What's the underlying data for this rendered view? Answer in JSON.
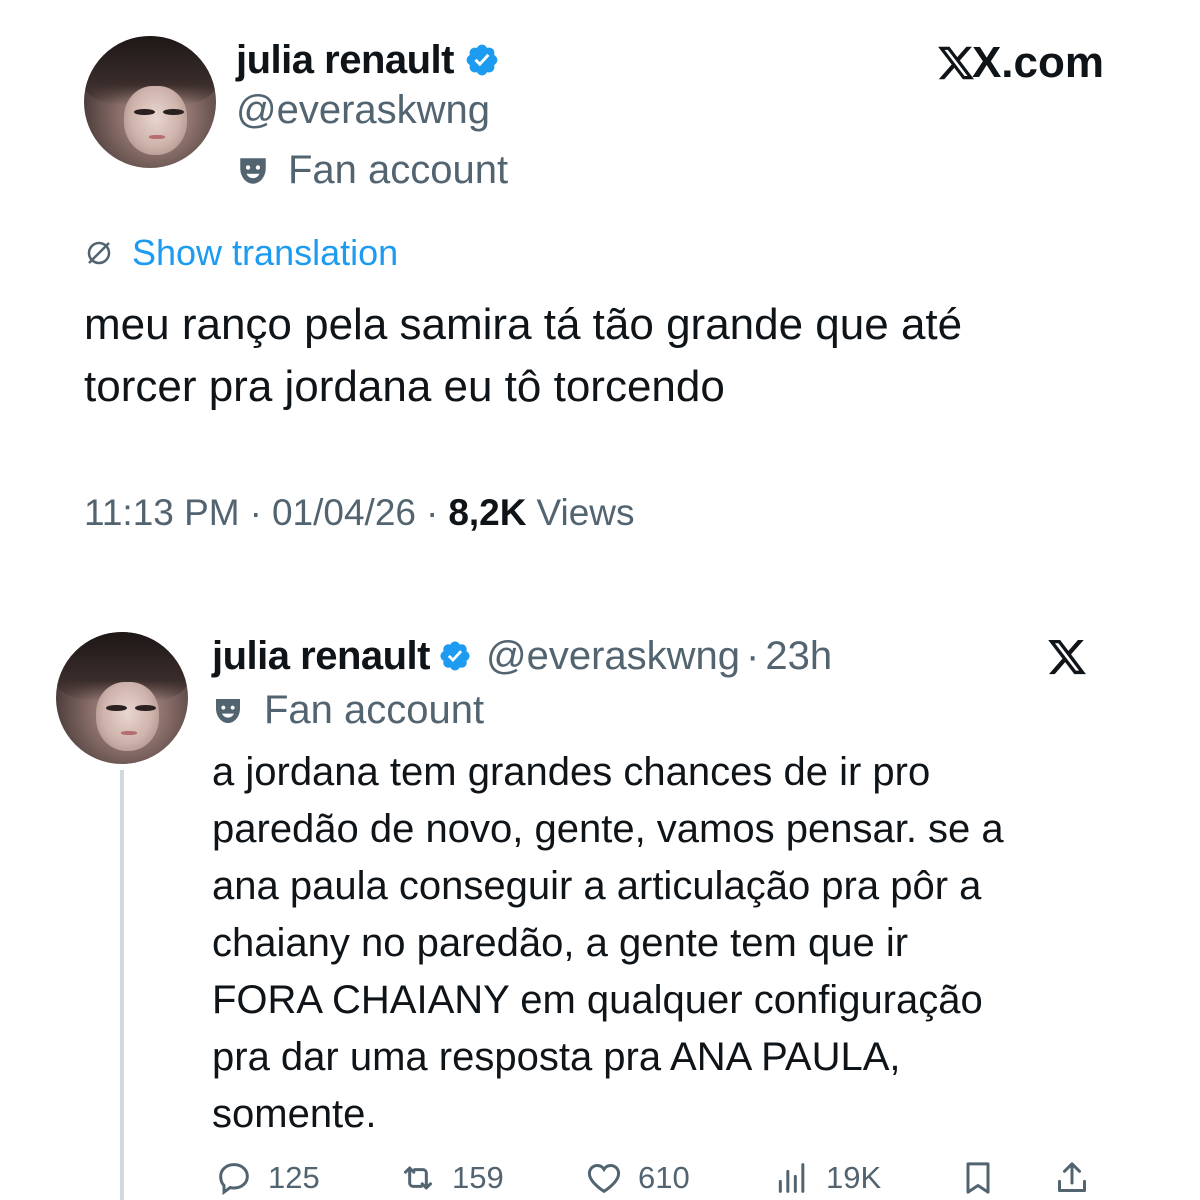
{
  "main_tweet": {
    "author": {
      "display_name": "julia renault",
      "handle": "@everaskwng",
      "label": "Fan account",
      "verified": true
    },
    "brand": "X.com",
    "show_translation": "Show translation",
    "text_lines": [
      "meu ranço pela samira tá tão grande que até",
      "torcer pra jordana eu tô torcendo"
    ],
    "meta": {
      "time": "11:13 PM",
      "separator": "·",
      "date": "01/04/26",
      "views_count": "8,2K",
      "views_label": "Views"
    }
  },
  "quoted_tweet": {
    "author": {
      "display_name": "julia renault",
      "handle": "@everaskwng",
      "separator": "·",
      "time": "23h",
      "label": "Fan account",
      "verified": true
    },
    "text_lines": [
      "a jordana tem grandes chances de ir pro",
      "paredão de novo, gente, vamos pensar. se a",
      "ana paula conseguir a articulação pra pôr a",
      "chaiany no paredão, a gente tem que ir",
      "FORA CHAIANY em qualquer configuração",
      "pra dar uma resposta pra ANA PAULA,",
      "somente."
    ],
    "actions": {
      "replies": "125",
      "reposts": "159",
      "likes": "610",
      "views": "19K"
    }
  },
  "icons": {
    "verified": "verified-badge-icon",
    "label": "theater-mask-icon",
    "translate": "translate-globe-icon",
    "brand": "x-logo-icon",
    "reply": "reply-icon",
    "repost": "repost-icon",
    "like": "heart-icon",
    "views": "views-bar-chart-icon",
    "bookmark": "bookmark-icon",
    "share": "share-icon"
  },
  "colors": {
    "text": "#0f1419",
    "secondary": "#536471",
    "accent": "#1d9bf0",
    "divider": "#cfd9de"
  }
}
